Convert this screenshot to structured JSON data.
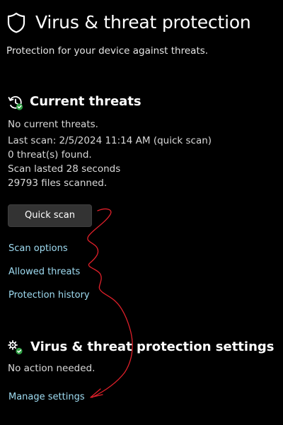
{
  "header": {
    "title": "Virus & threat protection",
    "subtitle": "Protection for your device against threats."
  },
  "current_threats": {
    "heading": "Current threats",
    "status": "No current threats.",
    "last_scan": "Last scan: 2/5/2024 11:14 AM (quick scan)",
    "threats_found": "0 threat(s) found.",
    "scan_duration": "Scan lasted 28 seconds",
    "files_scanned": "29793 files scanned.",
    "quick_scan_label": "Quick scan",
    "links": {
      "scan_options": "Scan options",
      "allowed_threats": "Allowed threats",
      "protection_history": "Protection history"
    }
  },
  "settings": {
    "heading": "Virus & threat protection settings",
    "status": "No action needed.",
    "manage_link": "Manage settings"
  },
  "colors": {
    "background": "#000000",
    "link": "#9fdcf2",
    "annotation": "#e0202a",
    "ok_badge": "#2ea043"
  },
  "icons": {
    "header": "shield-icon",
    "current_threats": "scan-history-icon",
    "settings": "settings-gears-icon"
  }
}
